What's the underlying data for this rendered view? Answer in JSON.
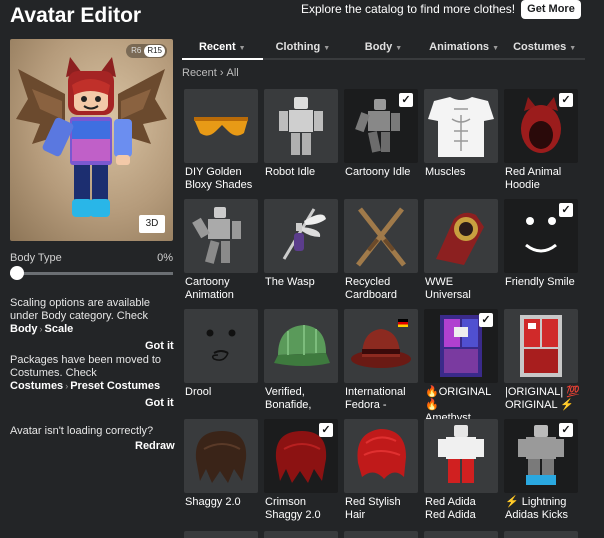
{
  "header": {
    "title": "Avatar Editor",
    "promo_text": "Explore the catalog to find more clothes!",
    "get_more_label": "Get More"
  },
  "preview": {
    "rig_options": [
      "R6",
      "R15"
    ],
    "rig_selected": "R15",
    "view_3d_label": "3D"
  },
  "body_type": {
    "label": "Body Type",
    "value": "0%",
    "fraction": 0
  },
  "tips": [
    {
      "text": "Scaling options are available under Body category. Check",
      "path_a": "Body",
      "path_b": "Scale",
      "dismiss": "Got it"
    },
    {
      "text": "Packages have been moved to Costumes. Check",
      "path_a": "Costumes",
      "path_b": "Preset Costumes",
      "dismiss": "Got it"
    }
  ],
  "loading_help": {
    "text": "Avatar isn't loading correctly?",
    "action": "Redraw"
  },
  "tabs": [
    {
      "label": "Recent",
      "active": true
    },
    {
      "label": "Clothing",
      "active": false
    },
    {
      "label": "Body",
      "active": false
    },
    {
      "label": "Animations",
      "active": false
    },
    {
      "label": "Costumes",
      "active": false
    }
  ],
  "breadcrumb": [
    "Recent",
    "All"
  ],
  "items": [
    {
      "label": "DIY Golden\nBloxy Shades",
      "selected": false,
      "icon": "sunglasses-icon"
    },
    {
      "label": "Robot Idle",
      "selected": false,
      "icon": "robot-figure-icon"
    },
    {
      "label": "Cartoony Idle",
      "selected": true,
      "icon": "idle-figure-icon"
    },
    {
      "label": "Muscles",
      "selected": false,
      "icon": "muscle-shirt-icon"
    },
    {
      "label": "Red Animal\nHoodie",
      "selected": true,
      "icon": "animal-hoodie-icon"
    },
    {
      "label": "Cartoony\nAnimation",
      "selected": false,
      "icon": "cartoony-figure-icon"
    },
    {
      "label": "The Wasp",
      "selected": false,
      "icon": "wasp-icon"
    },
    {
      "label": "Recycled\nCardboard",
      "selected": false,
      "icon": "crossed-swords-icon"
    },
    {
      "label": "WWE\nUniversal",
      "selected": false,
      "icon": "wwe-belt-icon"
    },
    {
      "label": "Friendly Smile",
      "selected": true,
      "icon": "smile-face-icon"
    },
    {
      "label": "Drool",
      "selected": false,
      "icon": "drool-face-icon"
    },
    {
      "label": "Verified,\nBonafide,",
      "selected": false,
      "icon": "green-cap-icon"
    },
    {
      "label": "International\nFedora -",
      "selected": false,
      "icon": "fedora-icon"
    },
    {
      "label": "🔥ORIGINAL🔥\nAmethyst",
      "selected": true,
      "icon": "amethyst-outfit-icon"
    },
    {
      "label": "|ORIGINAL| 💯\nORIGINAL ⚡",
      "selected": false,
      "icon": "red-outfit-icon"
    },
    {
      "label": "Shaggy 2.0",
      "selected": false,
      "icon": "brown-hair-icon"
    },
    {
      "label": "Crimson\nShaggy 2.0",
      "selected": true,
      "icon": "red-hair-icon"
    },
    {
      "label": "Red Stylish\nHair",
      "selected": false,
      "icon": "red-stylish-hair-icon"
    },
    {
      "label": "Red Adida\nRed Adida",
      "selected": false,
      "icon": "red-adida-figure-icon"
    },
    {
      "label": "⚡ Lightning\nAdidas Kicks",
      "selected": true,
      "icon": "lightning-kicks-icon"
    }
  ],
  "colors": {
    "background": "#232527",
    "tile": "#393b3d",
    "tile_selected": "#1b1c1d",
    "accent": "#ffffff"
  }
}
